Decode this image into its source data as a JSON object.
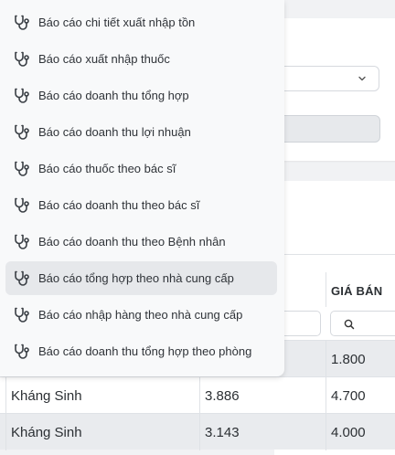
{
  "menu": {
    "items": [
      {
        "label": "Báo cáo chi tiết xuất nhập tồn",
        "icon": "stethoscope-icon"
      },
      {
        "label": "Báo cáo xuất nhập thuốc",
        "icon": "stethoscope-icon"
      },
      {
        "label": "Báo cáo doanh thu tổng hợp",
        "icon": "stethoscope-icon"
      },
      {
        "label": "Báo cáo doanh thu lợi nhuận",
        "icon": "stethoscope-icon"
      },
      {
        "label": "Báo cáo thuốc theo bác sĩ",
        "icon": "stethoscope-icon"
      },
      {
        "label": "Báo cáo doanh thu theo bác sĩ",
        "icon": "stethoscope-icon"
      },
      {
        "label": "Báo cáo doanh thu theo Bệnh nhân",
        "icon": "stethoscope-icon"
      },
      {
        "label": "Báo cáo tổng hợp theo nhà cung cấp",
        "icon": "stethoscope-icon",
        "active": true
      },
      {
        "label": "Báo cáo nhập hàng theo nhà cung cấp",
        "icon": "stethoscope-icon"
      },
      {
        "label": "Báo cáo doanh thu tổng hợp theo phòng",
        "icon": "stethoscope-icon"
      }
    ]
  },
  "table": {
    "price_header": "GIÁ BÁN",
    "rows": [
      {
        "group": "",
        "cost": "",
        "price": "1.800"
      },
      {
        "group": "Kháng Sinh",
        "cost": "3.886",
        "price": "4.700"
      },
      {
        "group": "Kháng Sinh",
        "cost": "3.143",
        "price": "4.000"
      }
    ]
  },
  "colors": {
    "menu_bg": "#f8f9fa",
    "active_bg": "#e6e8eb",
    "page_bg": "#f1f2f4"
  }
}
